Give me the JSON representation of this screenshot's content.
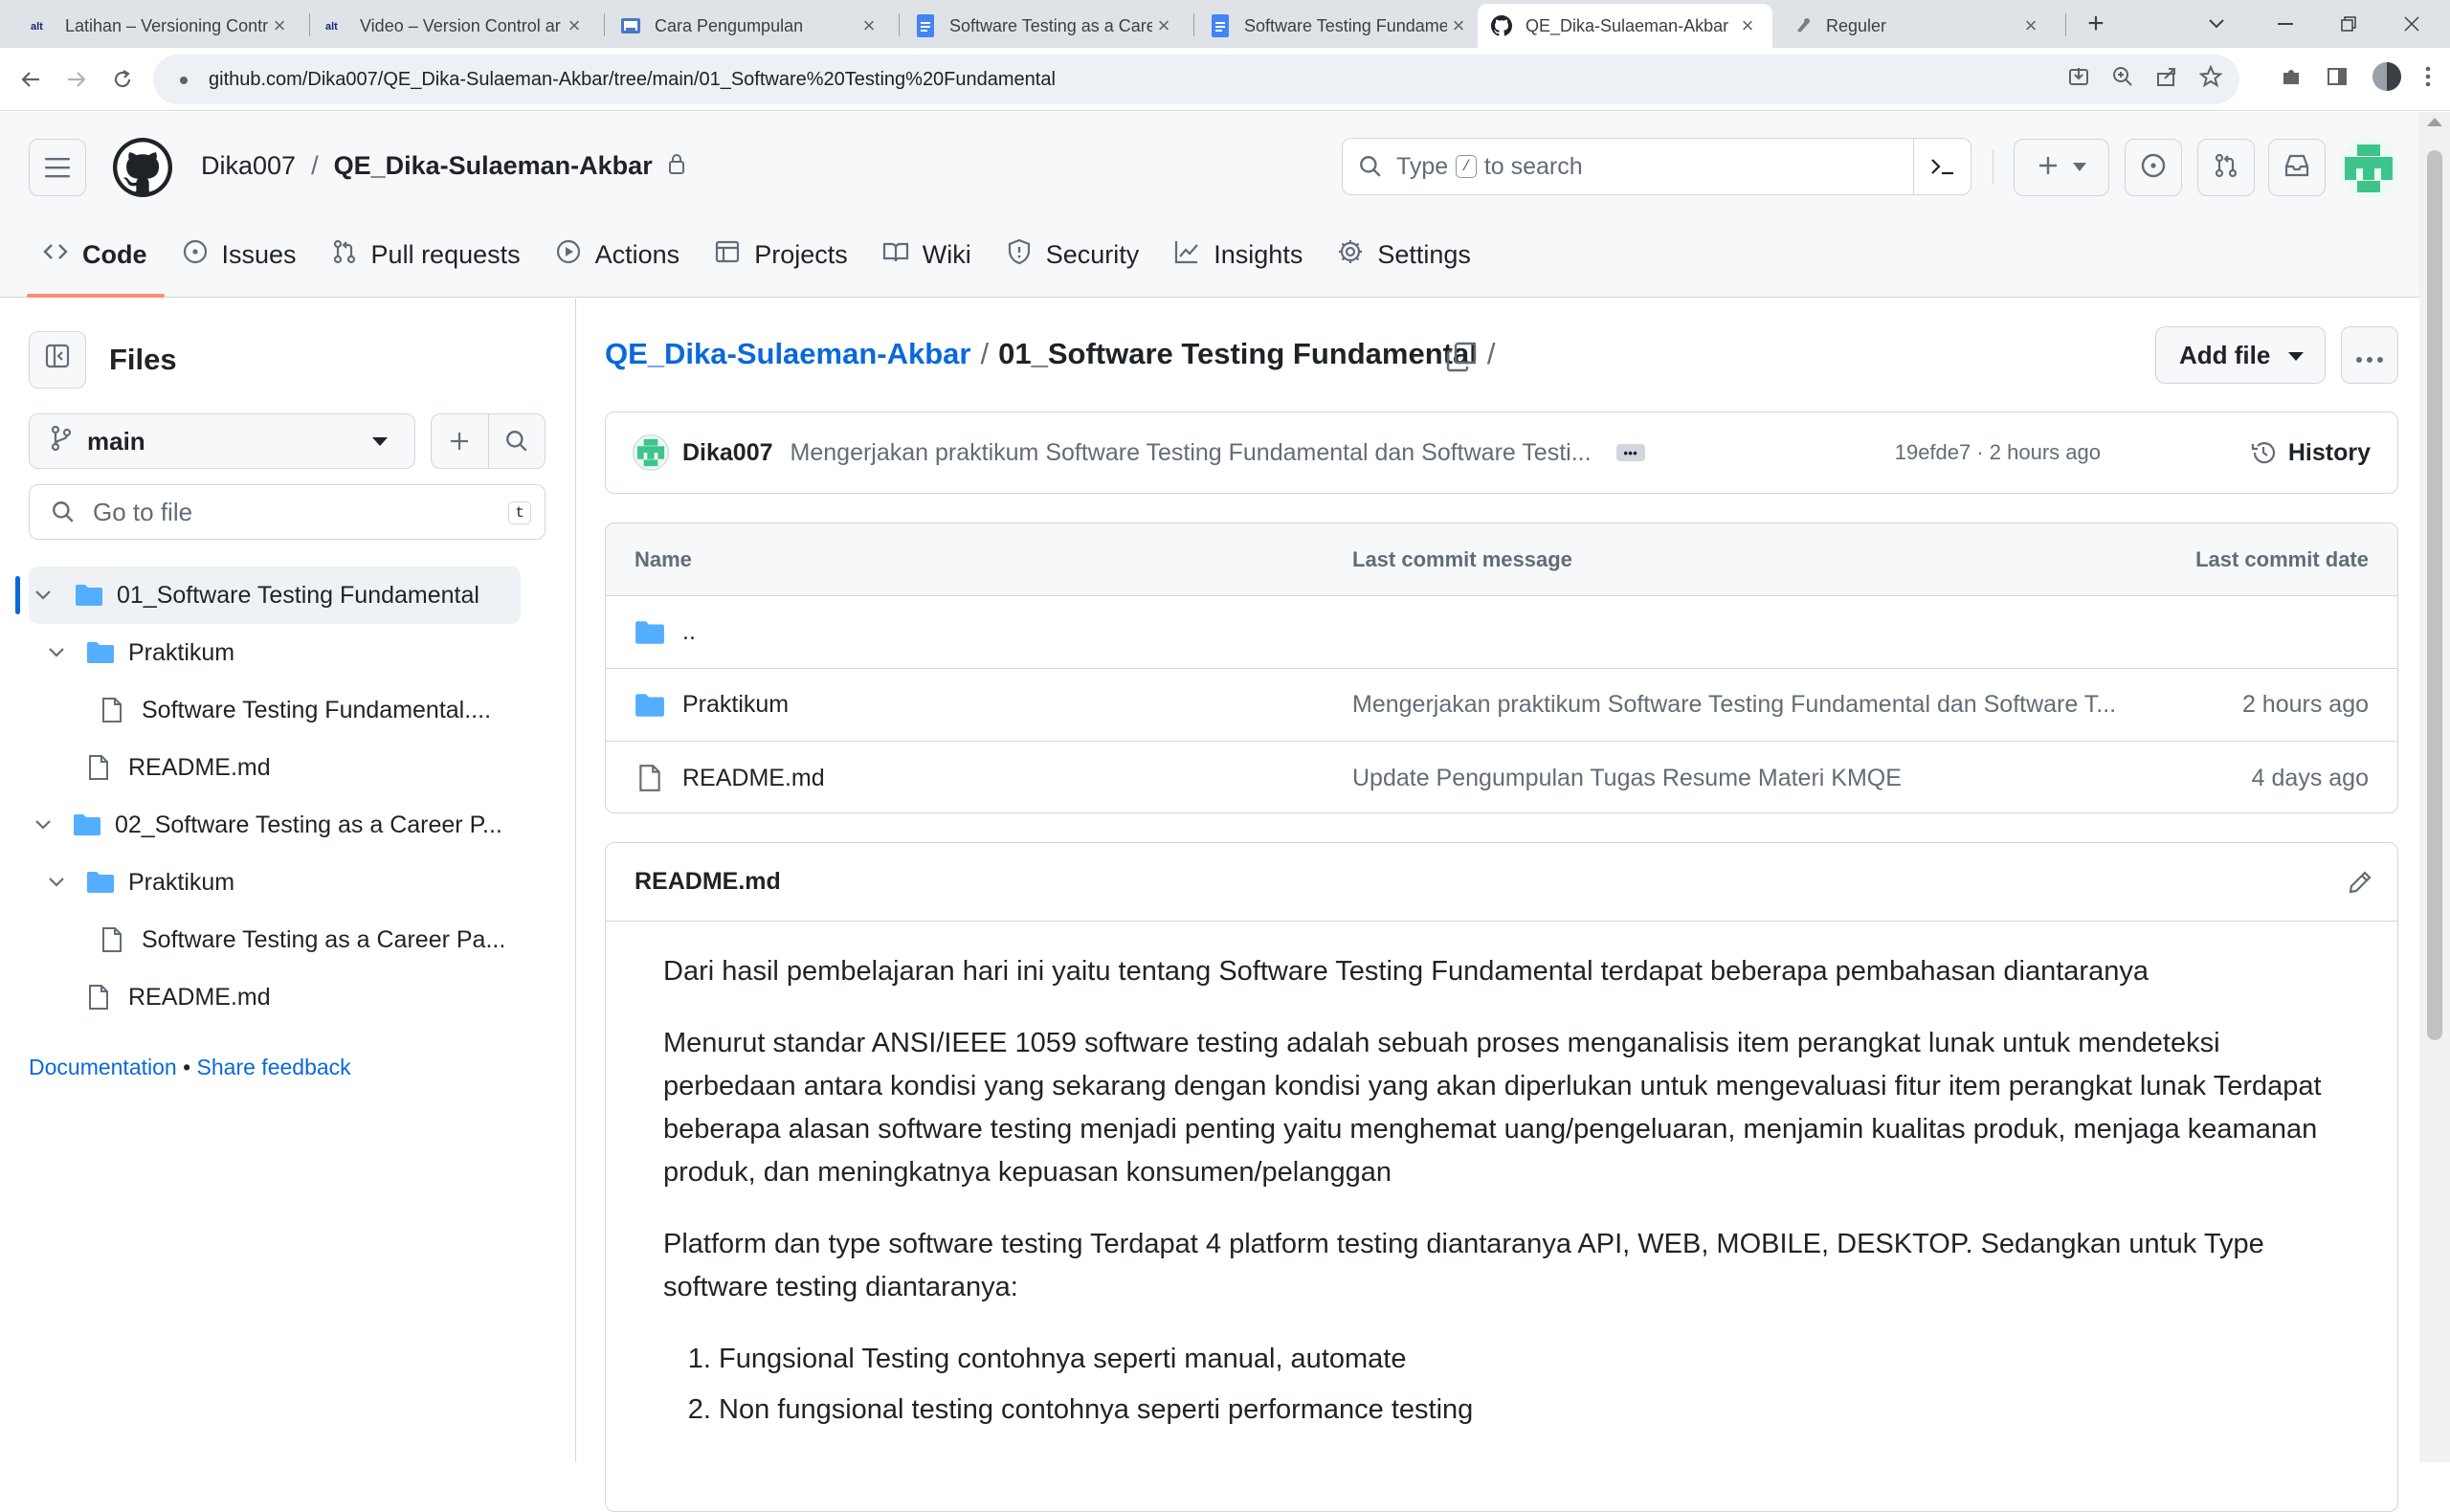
{
  "browser": {
    "tabs": [
      {
        "title": "Latihan – Versioning Contr",
        "favicon": "alterra-icon",
        "active": false
      },
      {
        "title": "Video – Version Control ar",
        "favicon": "alterra-icon",
        "active": false
      },
      {
        "title": "Cara Pengumpulan",
        "favicon": "classroom-icon",
        "active": false
      },
      {
        "title": "Software Testing as a Care",
        "favicon": "docs-icon",
        "active": false
      },
      {
        "title": "Software Testing Fundame",
        "favicon": "docs-icon",
        "active": false
      },
      {
        "title": "QE_Dika-Sulaeman-Akbar",
        "favicon": "github-icon",
        "active": true
      },
      {
        "title": "Reguler",
        "favicon": "pin-icon",
        "active": false
      }
    ],
    "url": "github.com/Dika007/QE_Dika-Sulaeman-Akbar/tree/main/01_Software%20Testing%20Fundamental"
  },
  "header": {
    "owner": "Dika007",
    "repo": "QE_Dika-Sulaeman-Akbar",
    "search_prefix": "Type",
    "search_key": "/",
    "search_suffix": "to search"
  },
  "repo_nav": [
    {
      "label": "Code",
      "icon": "code-icon",
      "active": true
    },
    {
      "label": "Issues",
      "icon": "issue-icon"
    },
    {
      "label": "Pull requests",
      "icon": "pull-request-icon"
    },
    {
      "label": "Actions",
      "icon": "play-icon"
    },
    {
      "label": "Projects",
      "icon": "table-icon"
    },
    {
      "label": "Wiki",
      "icon": "book-icon"
    },
    {
      "label": "Security",
      "icon": "shield-icon"
    },
    {
      "label": "Insights",
      "icon": "graph-icon"
    },
    {
      "label": "Settings",
      "icon": "gear-icon"
    }
  ],
  "sidebar": {
    "title": "Files",
    "branch": "main",
    "go_to_file_placeholder": "Go to file",
    "go_to_file_key": "t",
    "tree": [
      {
        "label": "01_Software Testing Fundamental",
        "type": "folder",
        "level": 0,
        "expanded": true,
        "selected": true
      },
      {
        "label": "Praktikum",
        "type": "folder",
        "level": 1,
        "expanded": true
      },
      {
        "label": "Software Testing Fundamental....",
        "type": "file",
        "level": 2
      },
      {
        "label": "README.md",
        "type": "file",
        "level": 1
      },
      {
        "label": "02_Software Testing as a Career P...",
        "type": "folder",
        "level": 0,
        "expanded": true
      },
      {
        "label": "Praktikum",
        "type": "folder",
        "level": 1,
        "expanded": true
      },
      {
        "label": "Software Testing as a Career Pa...",
        "type": "file",
        "level": 2
      },
      {
        "label": "README.md",
        "type": "file",
        "level": 1
      }
    ],
    "documentation": "Documentation",
    "bullet": "•",
    "feedback": "Share feedback"
  },
  "main": {
    "breadcrumb_root": "QE_Dika-Sulaeman-Akbar",
    "breadcrumb_current": "01_Software Testing Fundamental",
    "add_file": "Add file",
    "commit": {
      "author": "Dika007",
      "message": "Mengerjakan praktikum Software Testing Fundamental dan Software Testi...",
      "meta": "19efde7 · 2 hours ago",
      "history": "History"
    },
    "table": {
      "headers": {
        "name": "Name",
        "message": "Last commit message",
        "date": "Last commit date"
      },
      "parent": "..",
      "rows": [
        {
          "name": "Praktikum",
          "type": "folder",
          "message": "Mengerjakan praktikum Software Testing Fundamental dan Software T...",
          "date": "2 hours ago"
        },
        {
          "name": "README.md",
          "type": "file",
          "message": "Update Pengumpulan Tugas Resume Materi KMQE",
          "date": "4 days ago"
        }
      ]
    },
    "readme": {
      "title": "README.md",
      "p1": "Dari hasil pembelajaran hari ini yaitu tentang Software Testing Fundamental terdapat beberapa pembahasan diantaranya",
      "p2": "Menurut standar ANSI/IEEE 1059 software testing adalah sebuah proses menganalisis item perangkat lunak untuk mendeteksi perbedaan antara kondisi yang sekarang dengan kondisi yang akan diperlukan untuk mengevaluasi fitur item perangkat lunak Terdapat beberapa alasan software testing menjadi penting yaitu menghemat uang/pengeluaran, menjamin kualitas produk, menjaga keamanan produk, dan meningkatnya kepuasan konsumen/pelanggan",
      "p3": "Platform dan type software testing Terdapat 4 platform testing diantaranya API, WEB, MOBILE, DESKTOP. Sedangkan untuk Type software testing diantaranya:",
      "list": [
        "Fungsional Testing contohnya seperti manual, automate",
        "Non fungsional testing contohnya seperti performance testing"
      ]
    }
  }
}
